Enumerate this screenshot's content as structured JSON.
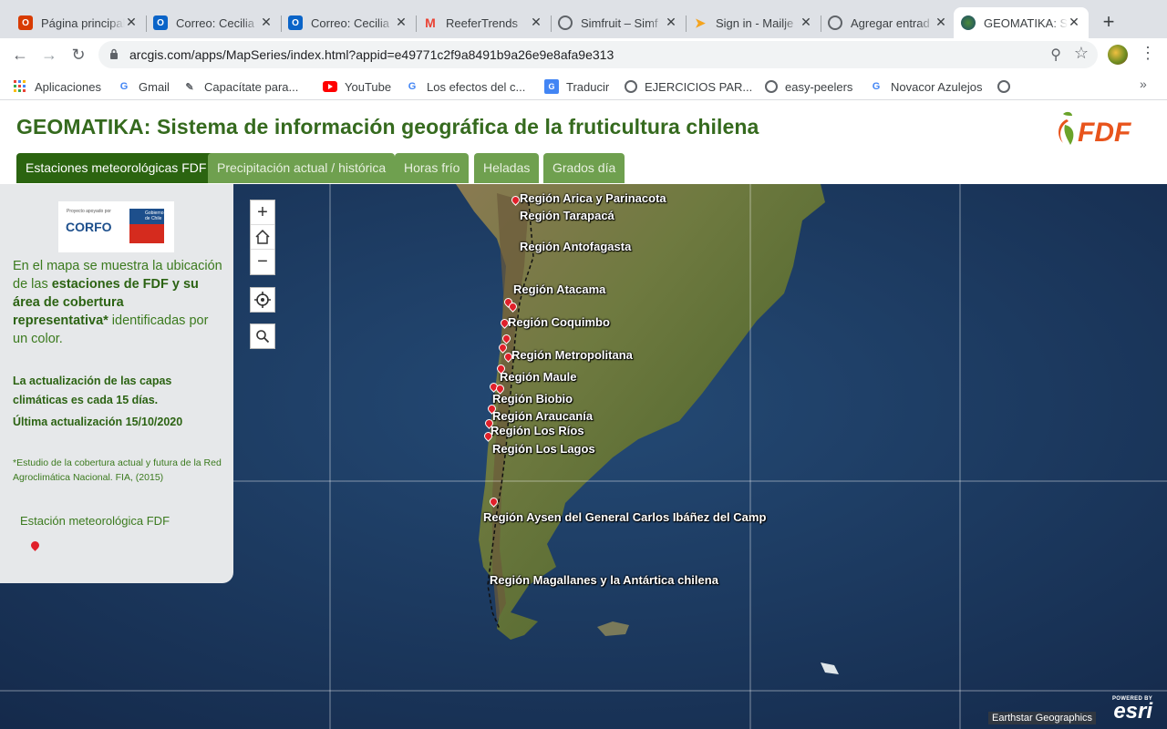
{
  "browser": {
    "tabs": [
      {
        "title": "Página principal",
        "icon": "office-icon",
        "color": "#d83b01"
      },
      {
        "title": "Correo: Cecilia",
        "icon": "outlook-icon",
        "color": "#0a64c8"
      },
      {
        "title": "Correo: Cecilia",
        "icon": "outlook-icon",
        "color": "#0a64c8"
      },
      {
        "title": "ReeferTrends",
        "icon": "gmail-icon",
        "color": "#ea4335"
      },
      {
        "title": "Simfruit – Simf",
        "icon": "globe-icon",
        "color": "#5f6368"
      },
      {
        "title": "Sign in - Mailje",
        "icon": "mailjet-icon",
        "color": "#f4a41f"
      },
      {
        "title": "Agregar entrad",
        "icon": "globe-icon",
        "color": "#5f6368"
      },
      {
        "title": "GEOMATIKA: S",
        "icon": "arcgis-globe-icon",
        "color": "#2f6b3a"
      }
    ],
    "url": "arcgis.com/apps/MapSeries/index.html?appid=e49771c2f9a8491b9a26e9e8afa9e313",
    "bookmarks": [
      {
        "label": "Aplicaciones",
        "icon": "apps-grid-icon"
      },
      {
        "label": "Gmail",
        "icon": "google-icon"
      },
      {
        "label": "Capacítate para...",
        "icon": "edit-page-icon"
      },
      {
        "label": "YouTube",
        "icon": "youtube-icon"
      },
      {
        "label": "Los efectos del c...",
        "icon": "google-icon"
      },
      {
        "label": "Traducir",
        "icon": "translate-icon"
      },
      {
        "label": "EJERCICIOS PAR...",
        "icon": "globe-icon"
      },
      {
        "label": "easy-peelers",
        "icon": "globe-icon"
      },
      {
        "label": "Novacor Azulejos",
        "icon": "google-icon"
      },
      {
        "label": "",
        "icon": "globe-icon"
      }
    ]
  },
  "app": {
    "title": "GEOMATIKA: Sistema de información geográfica de la fruticultura chilena",
    "logo_text": "FDF",
    "tabs": [
      {
        "label": "Estaciones meteorológicas FDF",
        "active": true
      },
      {
        "label": "Precipitación actual / histórica",
        "active": false
      },
      {
        "label": "Horas frío",
        "active": false
      },
      {
        "label": "Heladas",
        "active": false
      },
      {
        "label": "Grados día",
        "active": false
      }
    ],
    "colors": {
      "title_green": "#356a1e",
      "active_tab": "#2b6410",
      "inactive_tab": "#6fa04f",
      "pin_red": "#e0202a"
    }
  },
  "panel": {
    "corfo_small": "Proyecto apoyado por",
    "corfo_name": "CORFO",
    "gov_text": "Gobierno de Chile",
    "intro_1": "En el mapa se muestra la ubicación de las ",
    "intro_bold": "estaciones de FDF y su área de cobertura representativa*",
    "intro_2": "  identificadas por un color.",
    "update_note": "La actualización de las capas climáticas es cada 15 días.",
    "last_update": "Última actualización 15/10/2020",
    "footnote": "*Estudio de la cobertura actual y futura de la Red Agroclimática Nacional. FIA, (2015)",
    "legend_label": "Estación meteorológica FDF"
  },
  "map": {
    "regions": [
      "Región Arica y Parinacota",
      "Región Tarapacá",
      "Región Antofagasta",
      "Región Atacama",
      "Región Coquimbo",
      "Región Metropolitana",
      "Región Maule",
      "Región Biobio",
      "Región Araucanía",
      "Región Los Ríos",
      "Región Los Lagos",
      "Región Aysen del General Carlos Ibáñez del Camp",
      "Región Magallanes y la Antártica chilena"
    ],
    "attribution": "Earthstar Geographics",
    "esri_powered": "POWERED BY",
    "esri_name": "esri"
  }
}
